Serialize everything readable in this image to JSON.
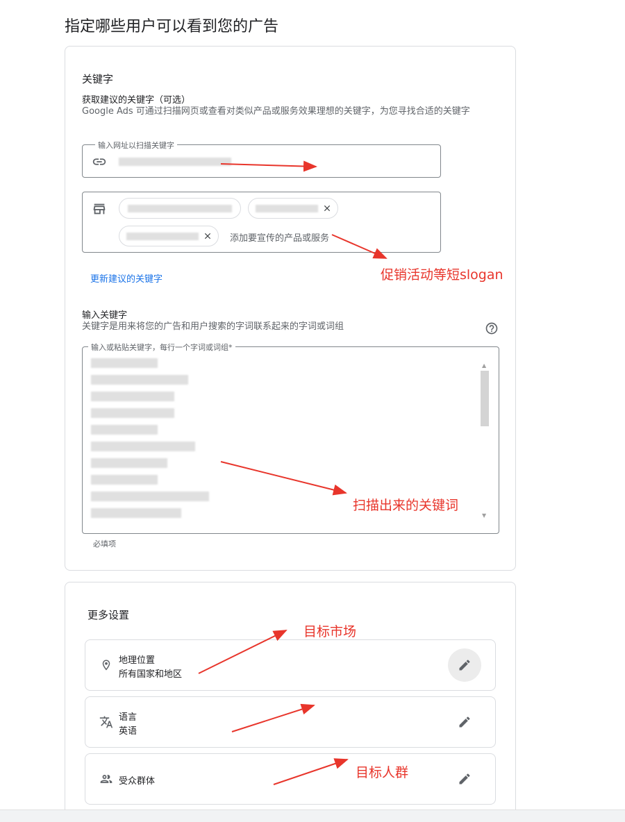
{
  "page_title": "指定哪些用户可以看到您的广告",
  "keywords_card": {
    "title": "关键字",
    "suggest_title": "获取建议的关键字（可选）",
    "suggest_desc": "Google Ads 可通过扫描网页或查看对类似产品或服务效果理想的关键字，为您寻找合适的关键字",
    "url_field_label": "输入网址以扫描关键字",
    "product_field_placeholder": "添加要宣传的产品或服务",
    "refresh_link": "更新建议的关键字",
    "enter_title": "输入关键字",
    "enter_desc": "关键字是用来将您的广告和用户搜索的字词联系起来的字词或词组",
    "textarea_label": "输入或粘贴关键字，每行一个字词或词组*",
    "required_hint": "必填项"
  },
  "more_settings": {
    "title": "更多设置",
    "rows": [
      {
        "title": "地理位置",
        "value": "所有国家和地区",
        "icon": "location-pin-icon"
      },
      {
        "title": "语言",
        "value": "英语",
        "icon": "translate-icon"
      },
      {
        "title": "受众群体",
        "value": "",
        "icon": "people-icon"
      }
    ]
  },
  "annotations": {
    "slogan": "促销活动等短slogan",
    "scanned": "扫描出来的关键词",
    "market": "目标市场",
    "audience": "目标人群"
  },
  "colors": {
    "annotation": "#e8352b",
    "link": "#1a73e8",
    "border": "#dadce0"
  }
}
